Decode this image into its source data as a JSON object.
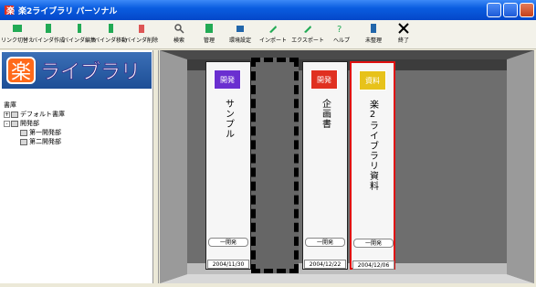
{
  "window": {
    "title": "楽2ライブラリ パーソナル"
  },
  "toolbar": {
    "items": [
      {
        "label": "リンク切替え",
        "icon": "link-icon",
        "color": "#2a5"
      },
      {
        "label": "バインダ作成",
        "icon": "binder-new-icon",
        "color": "#2a5"
      },
      {
        "label": "バインダ編集",
        "icon": "binder-edit-icon",
        "color": "#2a5"
      },
      {
        "label": "バインダ移動",
        "icon": "binder-move-icon",
        "color": "#2a5"
      },
      {
        "label": "バインダ削除",
        "icon": "binder-delete-icon",
        "color": "#d55"
      },
      {
        "label": "検索",
        "icon": "search-icon",
        "color": "#777"
      },
      {
        "label": "管理",
        "icon": "manage-icon",
        "color": "#2a5"
      },
      {
        "label": "環境設定",
        "icon": "settings-icon",
        "color": "#26a"
      },
      {
        "label": "インポート",
        "icon": "import-icon",
        "color": "#2a5"
      },
      {
        "label": "エクスポート",
        "icon": "export-icon",
        "color": "#2a5"
      },
      {
        "label": "ヘルプ",
        "icon": "help-icon",
        "color": "#2a5"
      },
      {
        "label": "未整理",
        "icon": "unsorted-icon",
        "color": "#26a"
      },
      {
        "label": "終了",
        "icon": "exit-icon",
        "color": "#000"
      }
    ]
  },
  "logo": {
    "text": "楽 ライブラリ"
  },
  "tree": {
    "root": "書庫",
    "items": [
      {
        "label": "デフォルト書庫",
        "indent": 1,
        "expander": "+"
      },
      {
        "label": "開発部",
        "indent": 1,
        "expander": "-"
      },
      {
        "label": "第一開発部",
        "indent": 2,
        "expander": ""
      },
      {
        "label": "第二開発部",
        "indent": 2,
        "expander": ""
      }
    ]
  },
  "books": [
    {
      "badge": "開発",
      "badge_color": "#6a2fd0",
      "title": "サンプル",
      "dept": "一開発",
      "date": "2004/11/30",
      "selected": false
    },
    {
      "badge": "開発",
      "badge_color": "#e03020",
      "title": "企画書",
      "dept": "一開発",
      "date": "2004/12/22",
      "selected": false
    },
    {
      "badge": "資料",
      "badge_color": "#e7c21a",
      "title": "楽2ライブラリ資料",
      "dept": "一開発",
      "date": "2004/12/06",
      "selected": true
    }
  ]
}
